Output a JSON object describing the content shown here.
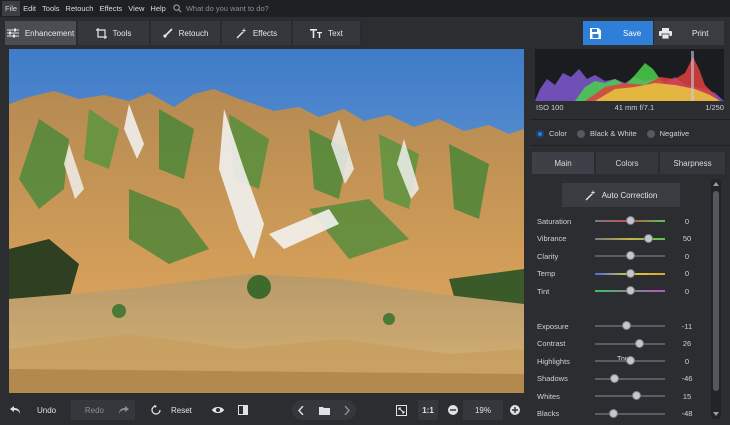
{
  "menu": {
    "items": [
      "File",
      "Edit",
      "Tools",
      "Retouch",
      "Effects",
      "View",
      "Help"
    ],
    "search_placeholder": "What do you want to do?"
  },
  "toolbar": {
    "tabs": [
      "Enhancement",
      "Tools",
      "Retouch",
      "Effects",
      "Text"
    ],
    "active_tab": "Enhancement",
    "save_label": "Save",
    "print_label": "Print"
  },
  "photo_info": {
    "iso": "ISO 100",
    "lens": "41 mm f/7.1",
    "shutter": "1/250"
  },
  "color_mode": {
    "options": [
      "Color",
      "Black & White",
      "Negative"
    ],
    "selected": "Color"
  },
  "panel_tabs": {
    "items": [
      "Main",
      "Colors",
      "Sharpness"
    ],
    "active": "Main"
  },
  "auto_correction_label": "Auto Correction",
  "sliders_top": [
    {
      "label": "Saturation",
      "value": "0",
      "fraction": 0.5
    },
    {
      "label": "Vibrance",
      "value": "50",
      "fraction": 0.75
    },
    {
      "label": "Clarity",
      "value": "0",
      "fraction": 0.5
    },
    {
      "label": "Temp",
      "value": "0",
      "fraction": 0.5
    },
    {
      "label": "Tint",
      "value": "0",
      "fraction": 0.5
    }
  ],
  "tone_label": "Tone",
  "sliders_tone": [
    {
      "label": "Exposure",
      "value": "-11",
      "fraction": 0.44
    },
    {
      "label": "Contrast",
      "value": "26",
      "fraction": 0.63
    },
    {
      "label": "Highlights",
      "value": "0",
      "fraction": 0.5
    },
    {
      "label": "Shadows",
      "value": "-46",
      "fraction": 0.27
    },
    {
      "label": "Whites",
      "value": "15",
      "fraction": 0.58
    },
    {
      "label": "Blacks",
      "value": "-48",
      "fraction": 0.26
    }
  ],
  "bottom": {
    "undo_label": "Undo",
    "redo_label": "Redo",
    "reset_label": "Reset",
    "zoom_fit_label": "1:1",
    "zoom_value": "19%"
  },
  "colors": {
    "accent": "#2f7fd9",
    "background": "#2b2d31",
    "menubar": "#1f2024"
  }
}
